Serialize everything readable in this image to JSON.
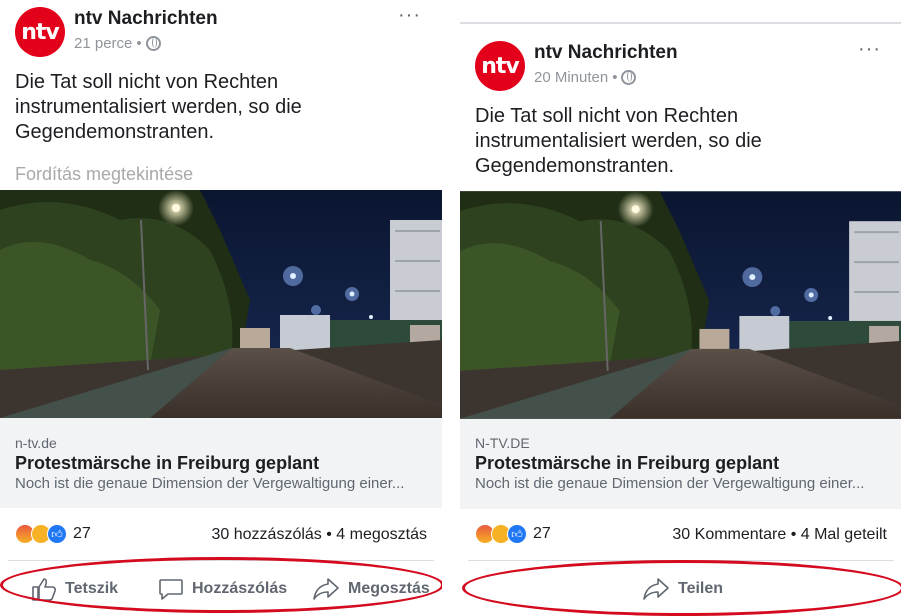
{
  "left_post": {
    "page_name": "ntv Nachrichten",
    "logo_text": "ntv",
    "time": "21 perce",
    "separator": "•",
    "more": "···",
    "text": "Die Tat soll nicht von Rechten instrumentalisiert werden, so die Gegendemonstranten.",
    "translate_link": "Fordítás megtekintése",
    "link_domain": "n-tv.de",
    "link_title": "Protestmärsche in Freiburg geplant",
    "link_desc": "Noch ist die genaue Dimension der Vergewaltigung einer...",
    "reaction_count": "27",
    "stats": "30 hozzászólás • 4 megosztás",
    "actions": {
      "like": "Tetszik",
      "comment": "Hozzászólás",
      "share": "Megosztás"
    }
  },
  "right_post": {
    "page_name": "ntv Nachrichten",
    "logo_text": "ntv",
    "time": "20 Minuten",
    "separator": "•",
    "more": "···",
    "text": "Die Tat soll nicht von Rechten instrumentalisiert werden, so die Gegendemonstranten.",
    "link_domain": "N-TV.DE",
    "link_title": "Protestmärsche in Freiburg geplant",
    "link_desc": "Noch ist die genaue Dimension der Vergewaltigung einer...",
    "reaction_count": "27",
    "stats": "30 Kommentare • 4 Mal geteilt",
    "actions": {
      "share": "Teilen"
    }
  },
  "colors": {
    "brand": "#e2001a",
    "annotation": "#d40a1e",
    "link_bg": "#f2f3f5",
    "facebook_like": "#2078f4"
  },
  "icons": [
    "ntv-logo-icon",
    "globe-icon",
    "more-icon",
    "angry-reaction-icon",
    "haha-reaction-icon",
    "like-reaction-icon",
    "thumbs-up-icon",
    "comment-icon",
    "share-icon"
  ]
}
